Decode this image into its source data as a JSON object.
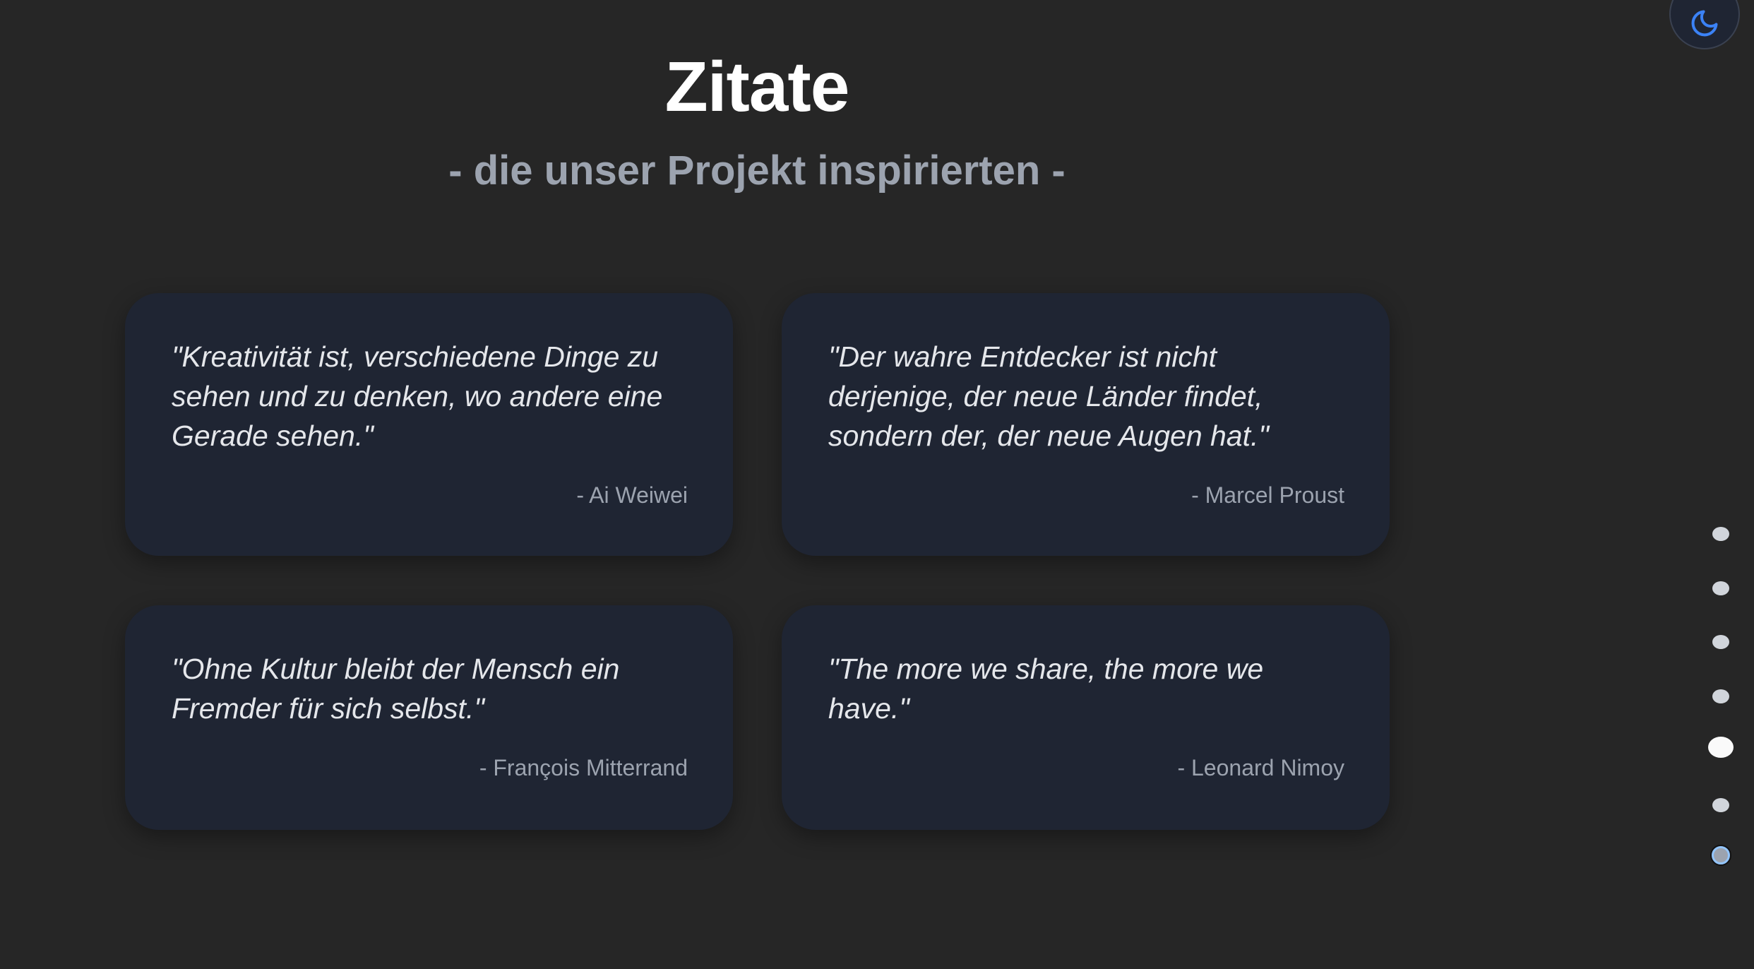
{
  "header": {
    "title": "Zitate",
    "subtitle": "- die unser Projekt inspirierten -"
  },
  "theme_toggle": {
    "icon": "moon-icon",
    "accent": "#3b82f6"
  },
  "quotes": [
    {
      "text": "\"Kreativität ist, verschiedene Dinge zu sehen und zu denken, wo andere eine Gerade sehen.\"",
      "author": "- Ai Weiwei"
    },
    {
      "text": "\"Der wahre Entdecker ist nicht derjenige, der neue Länder findet, sondern der, der neue Augen hat.\"",
      "author": "- Marcel Proust"
    },
    {
      "text": "\"Ohne Kultur bleibt der Mensch ein Fremder für sich selbst.\"",
      "author": "- François Mitterrand"
    },
    {
      "text": "\"The more we share, the more we have.\"",
      "author": "- Leonard Nimoy"
    }
  ],
  "section_nav": {
    "count": 7,
    "active_index": 4
  }
}
